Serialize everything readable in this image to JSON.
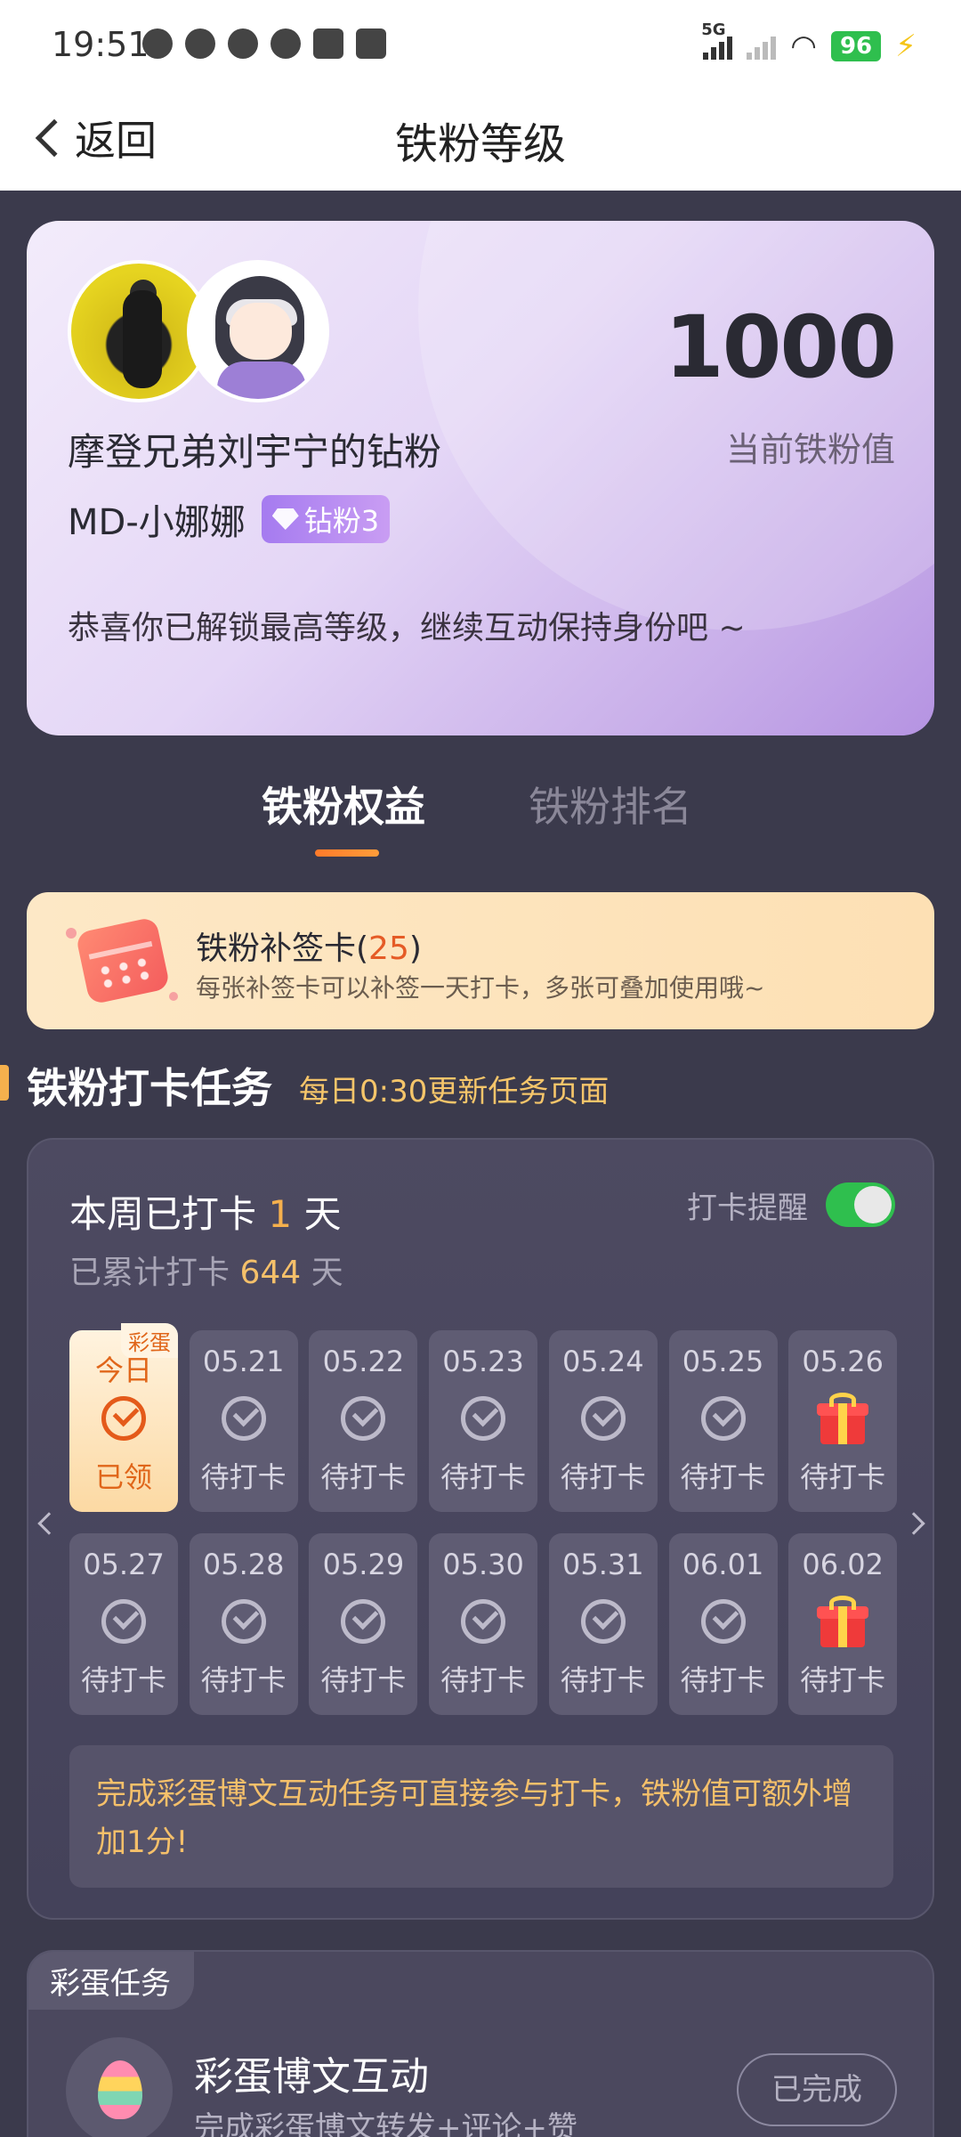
{
  "status_bar": {
    "time": "19:51",
    "network": "5G",
    "battery": "96"
  },
  "nav": {
    "back_label": "返回",
    "title": "铁粉等级"
  },
  "profile": {
    "score": "1000",
    "score_label": "当前铁粉值",
    "fan_title": "摩登兄弟刘宇宁的钻粉",
    "username": "MD-小娜娜",
    "badge": "钻粉3",
    "message": "恭喜你已解锁最高等级，继续互动保持身份吧 ~"
  },
  "tabs": {
    "active": "铁粉权益",
    "inactive": "铁粉排名"
  },
  "makeup_card": {
    "title": "铁粉补签卡(",
    "count": "25",
    "title_end": ")",
    "desc": "每张补签卡可以补签一天打卡，多张可叠加使用哦~"
  },
  "section": {
    "title": "铁粉打卡任务",
    "subtitle": "每日0:30更新任务页面"
  },
  "checkin": {
    "week_prefix": "本周已打卡 ",
    "week_count": "1",
    "week_suffix": " 天",
    "total_prefix": "已累计打卡 ",
    "total_count": "644",
    "total_suffix": " 天",
    "reminder_label": "打卡提醒",
    "reminder_on": true,
    "days": [
      {
        "date": "今日",
        "status": "已领",
        "tag": "彩蛋",
        "kind": "today"
      },
      {
        "date": "05.21",
        "status": "待打卡",
        "kind": "pending"
      },
      {
        "date": "05.22",
        "status": "待打卡",
        "kind": "pending"
      },
      {
        "date": "05.23",
        "status": "待打卡",
        "kind": "pending"
      },
      {
        "date": "05.24",
        "status": "待打卡",
        "kind": "pending"
      },
      {
        "date": "05.25",
        "status": "待打卡",
        "kind": "pending"
      },
      {
        "date": "05.26",
        "status": "待打卡",
        "kind": "gift"
      },
      {
        "date": "05.27",
        "status": "待打卡",
        "kind": "pending"
      },
      {
        "date": "05.28",
        "status": "待打卡",
        "kind": "pending"
      },
      {
        "date": "05.29",
        "status": "待打卡",
        "kind": "pending"
      },
      {
        "date": "05.30",
        "status": "待打卡",
        "kind": "pending"
      },
      {
        "date": "05.31",
        "status": "待打卡",
        "kind": "pending"
      },
      {
        "date": "06.01",
        "status": "待打卡",
        "kind": "pending"
      },
      {
        "date": "06.02",
        "status": "待打卡",
        "kind": "gift"
      }
    ],
    "note": "完成彩蛋博文互动任务可直接参与打卡，铁粉值可额外增加1分!"
  },
  "egg_task": {
    "tag": "彩蛋任务",
    "title": "彩蛋博文互动",
    "desc": "完成彩蛋博文转发+评论+赞",
    "button": "已完成"
  },
  "colors": {
    "background": "#3b3a4c",
    "accent_orange": "#f5b04d",
    "toggle_on": "#2fbf4e",
    "badge_purple": "#a57bf0"
  }
}
